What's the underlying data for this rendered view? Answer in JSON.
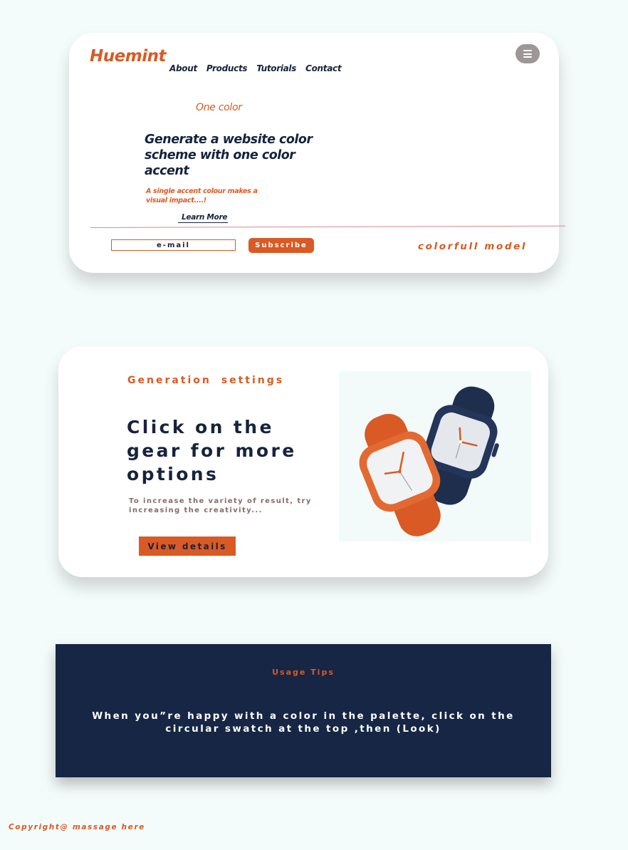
{
  "brand": {
    "logo": "Huemint",
    "accent": "#d95a24",
    "navy": "#17233d",
    "background": "#f4fcfb"
  },
  "nav": {
    "items": [
      "About",
      "Products",
      "Tutorials",
      "Contact"
    ]
  },
  "menu": {
    "icon": "hamburger-menu-icon"
  },
  "hero": {
    "eyebrow": "One color",
    "headline": "Generate a website color scheme with one color accent",
    "subtext": "A single accent colour makes a visual impact....!",
    "learn_more": "Learn More"
  },
  "subscribe_bar": {
    "email_placeholder": "e-mail",
    "subscribe_label": "Subscribe",
    "tagline": "colorfull model"
  },
  "settings": {
    "eyebrow": "Generation  settings",
    "headline": "Click on the gear for more options",
    "subtext": "To increase the variety of result, try increasing the creativity...",
    "button_label": "View details",
    "image": "smartwatches-image",
    "watch_colors": [
      "#d95a24",
      "#1e2e4d"
    ]
  },
  "tips": {
    "title": "Usage Tips",
    "body": "When you”re happy with a color in the palette, click on the circular swatch at the top ,then (Look)"
  },
  "footer": {
    "copyright": "Copyright@ massage here"
  }
}
